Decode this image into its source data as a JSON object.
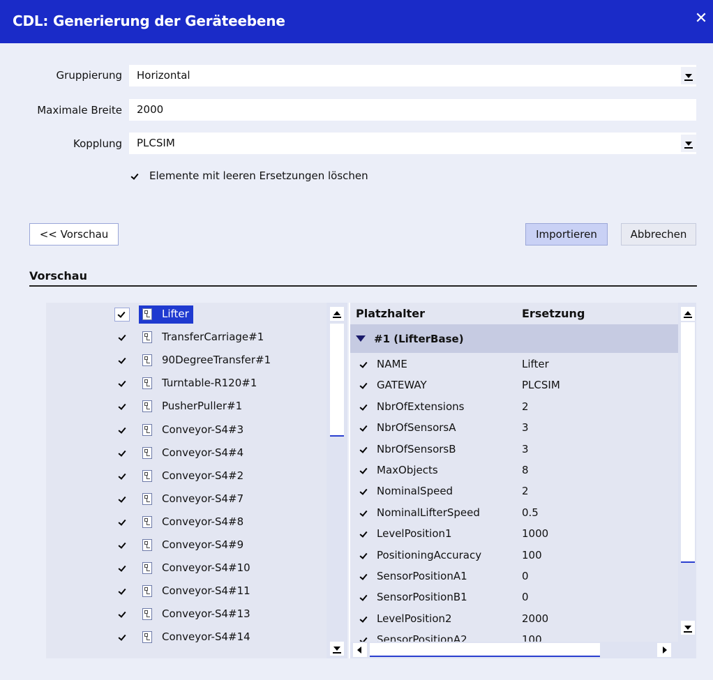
{
  "window": {
    "title": "CDL: Generierung der Geräteebene",
    "close": "✕"
  },
  "form": {
    "grouping_label": "Gruppierung",
    "grouping_value": "Horizontal",
    "max_width_label": "Maximale Breite",
    "max_width_value": "2000",
    "coupling_label": "Kopplung",
    "coupling_value": "PLCSIM",
    "delete_empty_label": "Elemente mit leeren Ersetzungen löschen",
    "delete_empty_checked": true
  },
  "buttons": {
    "preview": "<< Vorschau",
    "import": "Importieren",
    "cancel": "Abbrechen"
  },
  "preview_section": {
    "title": "Vorschau"
  },
  "tree": {
    "items": [
      {
        "label": "Lifter",
        "checked": true,
        "selected": true
      },
      {
        "label": "TransferCarriage#1",
        "checked": true
      },
      {
        "label": "90DegreeTransfer#1",
        "checked": true
      },
      {
        "label": "Turntable-R120#1",
        "checked": true
      },
      {
        "label": "PusherPuller#1",
        "checked": true
      },
      {
        "label": "Conveyor-S4#3",
        "checked": true
      },
      {
        "label": "Conveyor-S4#4",
        "checked": true
      },
      {
        "label": "Conveyor-S4#2",
        "checked": true
      },
      {
        "label": "Conveyor-S4#7",
        "checked": true
      },
      {
        "label": "Conveyor-S4#8",
        "checked": true
      },
      {
        "label": "Conveyor-S4#9",
        "checked": true
      },
      {
        "label": "Conveyor-S4#10",
        "checked": true
      },
      {
        "label": "Conveyor-S4#11",
        "checked": true
      },
      {
        "label": "Conveyor-S4#13",
        "checked": true
      },
      {
        "label": "Conveyor-S4#14",
        "checked": true
      }
    ]
  },
  "grid": {
    "col_placeholder": "Platzhalter",
    "col_replacement": "Ersetzung",
    "group_label": "#1 (LifterBase)",
    "rows": [
      {
        "name": "NAME",
        "value": "Lifter"
      },
      {
        "name": "GATEWAY",
        "value": "PLCSIM"
      },
      {
        "name": "NbrOfExtensions",
        "value": "2"
      },
      {
        "name": "NbrOfSensorsA",
        "value": "3"
      },
      {
        "name": "NbrOfSensorsB",
        "value": "3"
      },
      {
        "name": "MaxObjects",
        "value": "8"
      },
      {
        "name": "NominalSpeed",
        "value": "2"
      },
      {
        "name": "NominalLifterSpeed",
        "value": "0.5"
      },
      {
        "name": "LevelPosition1",
        "value": "1000"
      },
      {
        "name": "PositioningAccuracy",
        "value": "100"
      },
      {
        "name": "SensorPositionA1",
        "value": "0"
      },
      {
        "name": "SensorPositionB1",
        "value": "0"
      },
      {
        "name": "LevelPosition2",
        "value": "2000"
      },
      {
        "name": "SensorPositionA2",
        "value": "100"
      }
    ]
  },
  "colors": {
    "titlebar": "#1a2bc8",
    "selection": "#1f3ad0",
    "background": "#ebeef8"
  }
}
